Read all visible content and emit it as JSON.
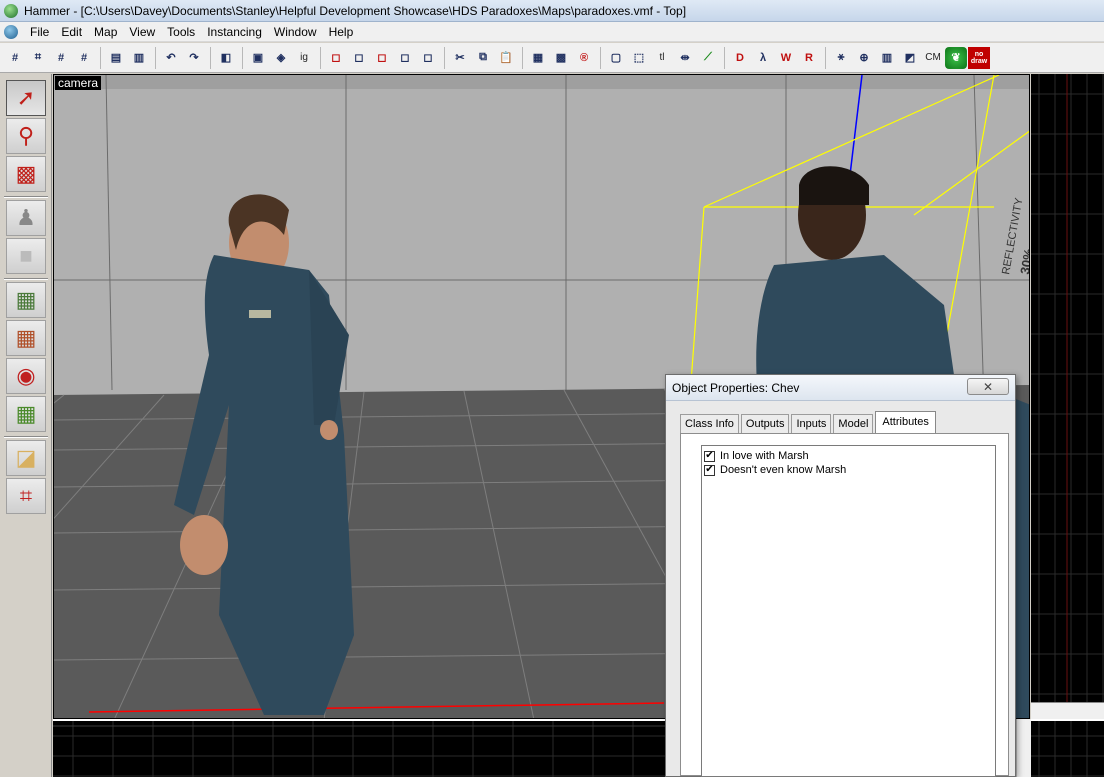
{
  "window": {
    "title": "Hammer - [C:\\Users\\Davey\\Documents\\Stanley\\Helpful Development Showcase\\HDS Paradoxes\\Maps\\paradoxes.vmf - Top]"
  },
  "menu": [
    "File",
    "Edit",
    "Map",
    "View",
    "Tools",
    "Instancing",
    "Window",
    "Help"
  ],
  "toolbar": {
    "cm_label": "CM",
    "nodraw_line1": "no",
    "nodraw_line2": "draw"
  },
  "viewport": {
    "label": "camera",
    "wall_markings": [
      "30%",
      "REFLECTIVITY"
    ]
  },
  "dialog": {
    "title": "Object Properties: Chev",
    "close_glyph": "✕",
    "tabs": [
      {
        "label": "Class Info",
        "active": false
      },
      {
        "label": "Outputs",
        "active": false
      },
      {
        "label": "Inputs",
        "active": false
      },
      {
        "label": "Model",
        "active": false
      },
      {
        "label": "Attributes",
        "active": true
      }
    ],
    "attributes": [
      {
        "label": "In love with Marsh",
        "checked": true
      },
      {
        "label": "Doesn't even know Marsh",
        "checked": true
      }
    ]
  },
  "colors": {
    "selection_box": "#ffff00",
    "axis_blue": "#0000ff",
    "axis_red": "#ff0000",
    "grid_2d": "#1f1f1f",
    "floor": "#5b5b5b",
    "wall": "#b3b3b3"
  },
  "palette_icons": [
    "selection-tool-icon",
    "magnify-tool-icon",
    "camera-tool-icon",
    "entity-tool-icon",
    "block-tool-icon",
    "texture-tool-icon",
    "apply-texture-icon",
    "decal-tool-icon",
    "overlay-tool-icon",
    "clip-tool-icon",
    "vertex-tool-icon"
  ]
}
